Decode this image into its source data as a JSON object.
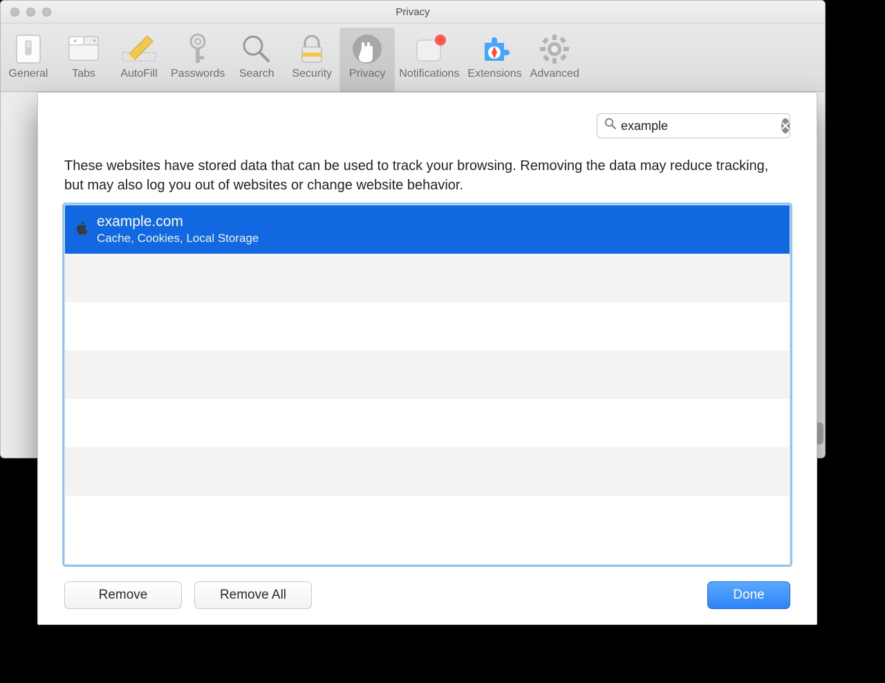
{
  "window": {
    "title": "Privacy"
  },
  "toolbar": {
    "general": "General",
    "tabs": "Tabs",
    "autofill": "AutoFill",
    "passwords": "Passwords",
    "search": "Search",
    "security": "Security",
    "privacy": "Privacy",
    "notifications": "Notifications",
    "extensions": "Extensions",
    "advanced": "Advanced"
  },
  "sheet": {
    "search_value": "example",
    "description": "These websites have stored data that can be used to track your browsing. Removing the data may reduce tracking, but may also log you out of websites or change website behavior.",
    "sites": [
      {
        "domain": "example.com",
        "detail": "Cache, Cookies, Local Storage",
        "selected": true
      }
    ],
    "remove": "Remove",
    "remove_all": "Remove All",
    "done": "Done"
  }
}
